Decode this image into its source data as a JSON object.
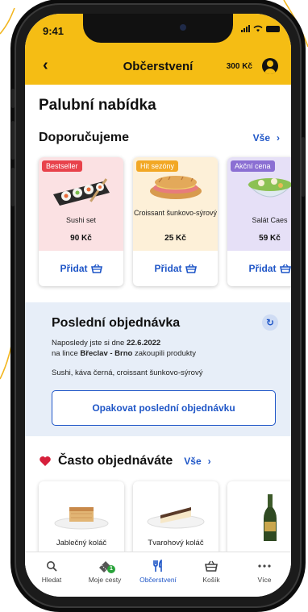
{
  "status": {
    "time": "9:41"
  },
  "appbar": {
    "title": "Občerstvení",
    "credit": "300 Kč"
  },
  "page": {
    "title": "Palubní nabídka"
  },
  "recommend": {
    "heading": "Doporučujeme",
    "all_link": "Vše",
    "add_label": "Přidat",
    "items": [
      {
        "badge": "Bestseller",
        "badge_color": "#e8424b",
        "bg": "#fbe1e3",
        "name": "Sushi set",
        "price": "90 Kč"
      },
      {
        "badge": "Hit sezóny",
        "badge_color": "#f2a825",
        "bg": "#fdf0d8",
        "name": "Croissant šunkovo-sýrový",
        "price": "25 Kč"
      },
      {
        "badge": "Akční cena",
        "badge_color": "#8b6fd3",
        "bg": "#e6e0f7",
        "name": "Salát Caes",
        "price": "59 Kč"
      }
    ]
  },
  "last_order": {
    "title": "Poslední objednávka",
    "line1_prefix": "Naposledy jste si dne",
    "date": "22.6.2022",
    "line2_prefix": "na lince",
    "route": "Břeclav - Brno",
    "line2_suffix": "zakoupili produkty",
    "products": "Sushi, káva černá, croissant šunkovo-sýrový",
    "repeat_label": "Opakovat poslední objednávku"
  },
  "frequent": {
    "heading": "Často objednáváte",
    "all_link": "Vše",
    "items": [
      {
        "name": "Jablečný koláč"
      },
      {
        "name": "Tvarohový koláč"
      },
      {
        "name": ""
      }
    ]
  },
  "tabs": [
    {
      "label": "Hledat",
      "icon": "search-icon"
    },
    {
      "label": "Moje cesty",
      "icon": "tickets-icon",
      "badge": "1"
    },
    {
      "label": "Občerstvení",
      "icon": "cutlery-icon",
      "active": true
    },
    {
      "label": "Košík",
      "icon": "basket-icon"
    },
    {
      "label": "Více",
      "icon": "more-icon"
    }
  ],
  "colors": {
    "brand_yellow": "#f5bd14",
    "link_blue": "#1f56c7",
    "heart_red": "#d61f3b"
  }
}
